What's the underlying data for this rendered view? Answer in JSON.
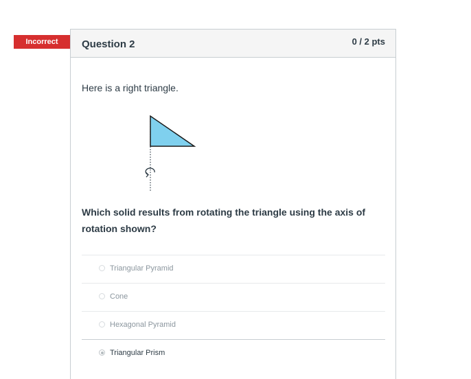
{
  "status_badge": {
    "label": "Incorrect",
    "color": "#d62f2f"
  },
  "question": {
    "title": "Question 2",
    "points": "0 / 2 pts",
    "intro": "Here is a right triangle.",
    "prompt": "Which solid results from rotating the triangle using the axis of rotation shown?",
    "figure": {
      "shape": "right-triangle",
      "fill_color": "#7fd0ee",
      "axis": "dotted-vertical",
      "rotation_icon": "rotate-arrow-icon"
    }
  },
  "answers": [
    {
      "label": "Triangular Pyramid",
      "selected": false
    },
    {
      "label": "Cone",
      "selected": false
    },
    {
      "label": "Hexagonal Pyramid",
      "selected": false
    },
    {
      "label": "Triangular Prism",
      "selected": true
    }
  ]
}
